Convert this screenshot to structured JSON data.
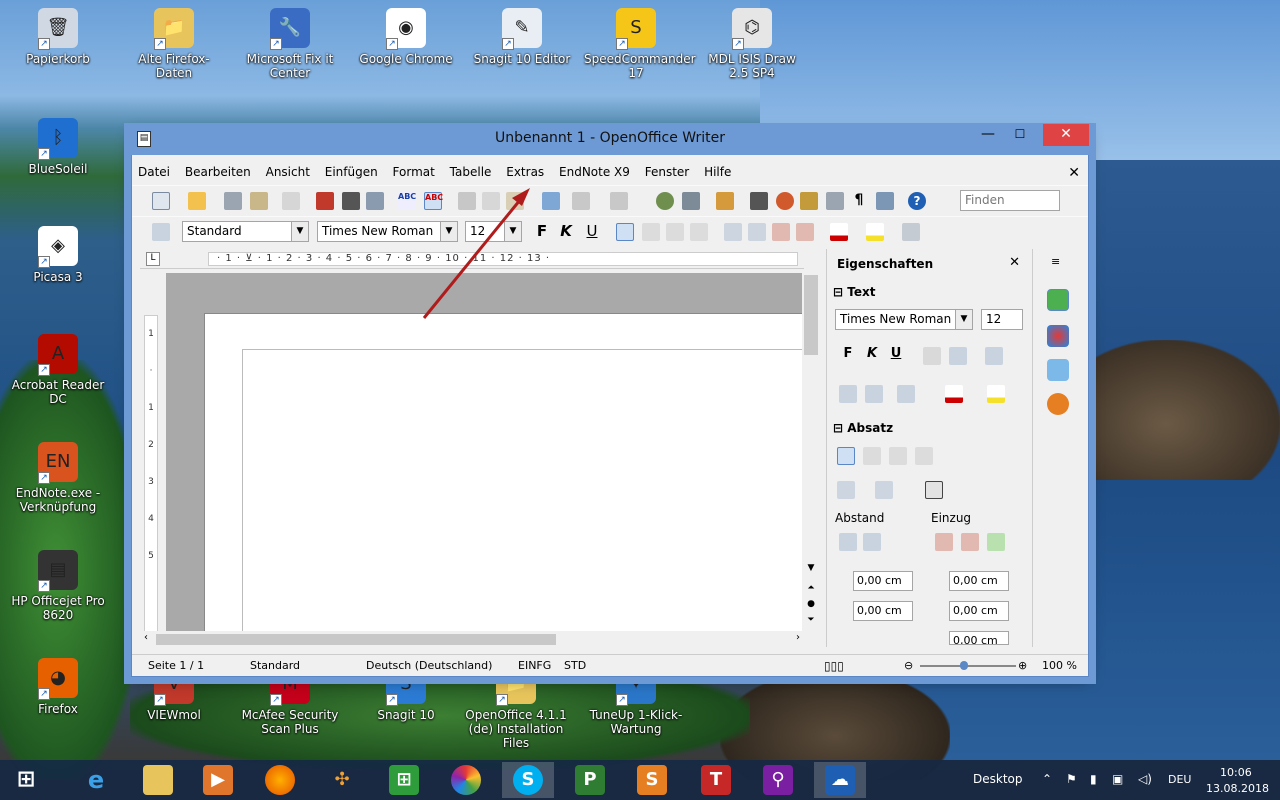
{
  "desktop_icons": [
    {
      "label": "Papierkorb",
      "color": "#cfd8e3",
      "glyph": "🗑"
    },
    {
      "label": "Alte Firefox-Daten",
      "color": "#e8c55c",
      "glyph": "📁"
    },
    {
      "label": "Microsoft Fix it Center",
      "color": "#3b6cc4",
      "glyph": "🔧"
    },
    {
      "label": "Google Chrome",
      "color": "#ffffff",
      "glyph": "◉"
    },
    {
      "label": "Snagit 10 Editor",
      "color": "#e8eef4",
      "glyph": "✎"
    },
    {
      "label": "SpeedCommander 17",
      "color": "#f5c518",
      "glyph": "S"
    },
    {
      "label": "MDL ISIS Draw 2.5 SP4",
      "color": "#e6e6e6",
      "glyph": "⌬"
    },
    {
      "label": "BlueSoleil",
      "color": "#1f6fd1",
      "glyph": "ᛒ"
    },
    {
      "label": "Picasa 3",
      "color": "#ffffff",
      "glyph": "◈"
    },
    {
      "label": "Acrobat Reader DC",
      "color": "#b30b00",
      "glyph": "A"
    },
    {
      "label": "EndNote.exe - Verknüpfung",
      "color": "#d9531e",
      "glyph": "EN"
    },
    {
      "label": "HP Officejet Pro 8620",
      "color": "#333333",
      "glyph": "▤"
    },
    {
      "label": "Firefox",
      "color": "#e66000",
      "glyph": "◕"
    },
    {
      "label": "VIEWmol",
      "color": "#c0392b",
      "glyph": "V"
    },
    {
      "label": "McAfee Security Scan Plus",
      "color": "#c4001a",
      "glyph": "M"
    },
    {
      "label": "Snagit 10",
      "color": "#2b7bd4",
      "glyph": "S"
    },
    {
      "label": "OpenOffice 4.1.1 (de) Installation Files",
      "color": "#e8c55c",
      "glyph": "📁"
    },
    {
      "label": "TuneUp 1-Klick-Wartung",
      "color": "#2a77c9",
      "glyph": "✦"
    }
  ],
  "window": {
    "title": "Unbenannt 1 - OpenOffice Writer",
    "minimize": "—",
    "maximize": "☐",
    "close": "✕"
  },
  "menu": [
    "Datei",
    "Bearbeiten",
    "Ansicht",
    "Einfügen",
    "Format",
    "Tabelle",
    "Extras",
    "EndNote X9",
    "Fenster",
    "Hilfe"
  ],
  "toolbar": {
    "find_placeholder": "Finden",
    "style": "Standard",
    "font": "Times New Roman",
    "size": "12",
    "bold": "F",
    "italic": "K",
    "underline": "U"
  },
  "ruler_scale": "· 1 · ⊻ · 1 · 2 · 3 · 4 · 5 · 6 · 7 · 8 · 9 · 10 · 11 · 12 · 13 ·",
  "vruler_scale": [
    "1",
    "·",
    "1",
    "2",
    "3",
    "4",
    "5"
  ],
  "sidebar": {
    "title": "Eigenschaften",
    "text_section": "Text",
    "font": "Times New Roman",
    "size": "12",
    "para_section": "Absatz",
    "abstand_label": "Abstand",
    "einzug_label": "Einzug",
    "spin_values": [
      "0,00 cm",
      "0,00 cm",
      "0,00 cm",
      "0,00 cm",
      "0,00 cm"
    ]
  },
  "statusbar": {
    "page": "Seite 1 / 1",
    "style": "Standard",
    "language": "Deutsch (Deutschland)",
    "insert": "EINFG",
    "std": "STD",
    "zoom": "100 %"
  },
  "taskbar": {
    "desktop_label": "Desktop",
    "lang": "DEU",
    "time": "10:06",
    "date": "13.08.2018"
  },
  "colors": {
    "accent": "#6d9ad4",
    "close": "#e04343",
    "annotation_arrow": "#b01c1c"
  }
}
